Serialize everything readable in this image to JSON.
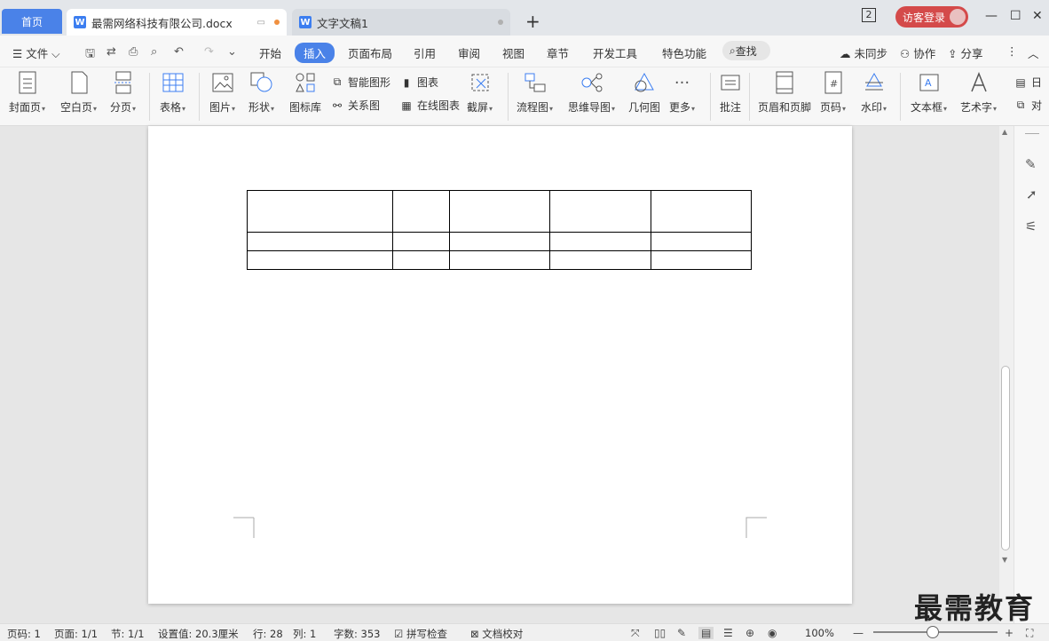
{
  "titlebar": {
    "home_tab": "首页",
    "tabs": [
      {
        "name": "最需网络科技有限公司.docx",
        "state": "modified"
      },
      {
        "name": "文字文稿1",
        "state": "saved"
      }
    ],
    "new_tab": "+",
    "page_count_badge": "2",
    "login_label": "访客登录"
  },
  "menu": {
    "file_label": "文件",
    "tabs": [
      "开始",
      "插入",
      "页面布局",
      "引用",
      "审阅",
      "视图",
      "章节",
      "开发工具",
      "特色功能"
    ],
    "active_tab": "插入",
    "search_label": "查找",
    "sync_label": "未同步",
    "collab_label": "协作",
    "share_label": "分享"
  },
  "ribbon": {
    "cover": "封面页",
    "blank": "空白页",
    "pagebreak": "分页",
    "table": "表格",
    "picture": "图片",
    "shape": "形状",
    "iconlib": "图标库",
    "smartart": "智能图形",
    "relation": "关系图",
    "chart": "图表",
    "online_chart": "在线图表",
    "screenshot": "截屏",
    "flowchart": "流程图",
    "mindmap": "思维导图",
    "geometry": "几何图",
    "more": "更多",
    "comment": "批注",
    "header_footer": "页眉和页脚",
    "page_number": "页码",
    "watermark": "水印",
    "textbox": "文本框",
    "wordart": "艺术字",
    "date_partial": "日",
    "object_partial": "对"
  },
  "document": {
    "table": {
      "rows": 3,
      "cols": 5
    }
  },
  "status": {
    "page_no": "页码: 1",
    "pages": "页面: 1/1",
    "section": "节: 1/1",
    "setting": "设置值: 20.3厘米",
    "row": "行: 28",
    "col": "列: 1",
    "words": "字数: 353",
    "spellcheck": "拼写检查",
    "proofread": "文档校对",
    "zoom": "100%"
  },
  "watermark_text": "最需教育"
}
